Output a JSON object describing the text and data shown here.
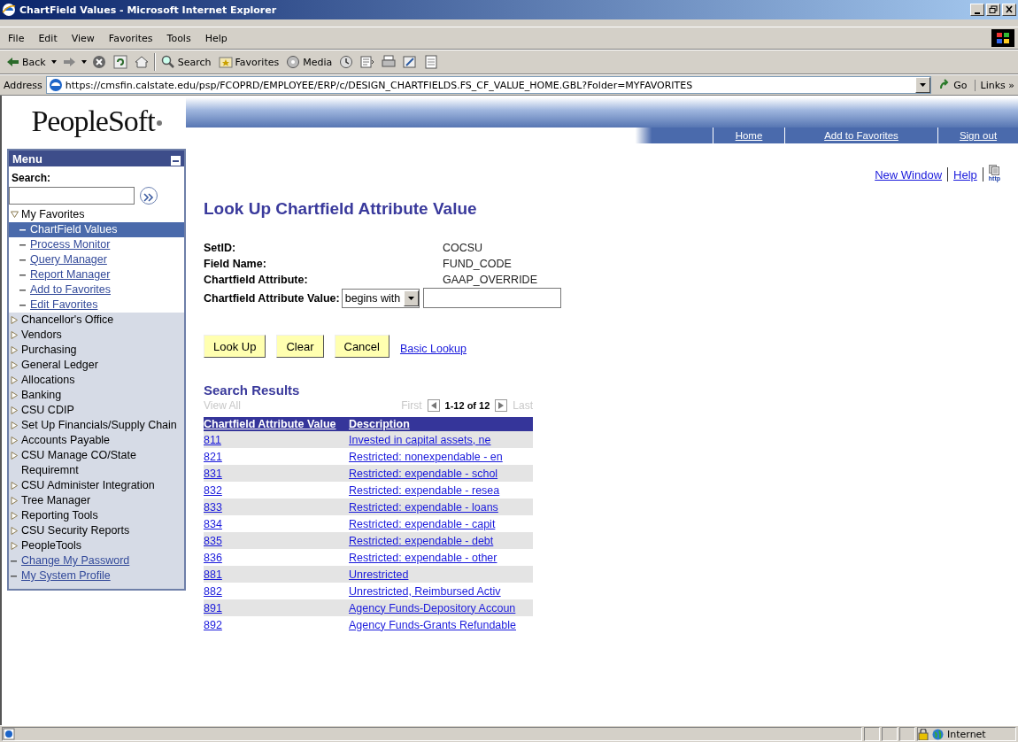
{
  "window": {
    "title": "ChartField Values - Microsoft Internet Explorer"
  },
  "menu_bar": [
    "File",
    "Edit",
    "View",
    "Favorites",
    "Tools",
    "Help"
  ],
  "toolbar": [
    {
      "kind": "back",
      "label": "Back"
    },
    {
      "kind": "forward"
    },
    {
      "kind": "stop"
    },
    {
      "kind": "refresh"
    },
    {
      "kind": "home"
    },
    {
      "kind": "search",
      "label": "Search"
    },
    {
      "kind": "favorites",
      "label": "Favorites"
    },
    {
      "kind": "media",
      "label": "Media"
    },
    {
      "kind": "history"
    },
    {
      "kind": "mail"
    },
    {
      "kind": "print"
    },
    {
      "kind": "edit"
    },
    {
      "kind": "discuss"
    }
  ],
  "address_bar": {
    "label": "Address",
    "url": "https://cmsfin.calstate.edu/psp/FCOPRD/EMPLOYEE/ERP/c/DESIGN_CHARTFIELDS.FS_CF_VALUE_HOME.GBL?Folder=MYFAVORITES",
    "go": "Go",
    "links": "Links »"
  },
  "logo": "PeopleSoft",
  "header_links": [
    "Home",
    "Add to Favorites",
    "Sign out"
  ],
  "menu": {
    "title": "Menu",
    "search_label": "Search:",
    "items": [
      {
        "kind": "folder",
        "label": "My Favorites",
        "expanded": true,
        "children": [
          {
            "kind": "link",
            "label": "ChartField Values",
            "selected": true
          },
          {
            "kind": "link",
            "label": "Process Monitor",
            "selected": false
          },
          {
            "kind": "link",
            "label": "Query Manager",
            "selected": false
          },
          {
            "kind": "link",
            "label": "Report Manager",
            "selected": false
          },
          {
            "kind": "link",
            "label": "Add to Favorites",
            "selected": false
          },
          {
            "kind": "link",
            "label": "Edit Favorites",
            "selected": false
          }
        ]
      },
      {
        "kind": "folder",
        "label": "Chancellor's Office",
        "expanded": false
      },
      {
        "kind": "folder",
        "label": "Vendors",
        "expanded": false
      },
      {
        "kind": "folder",
        "label": "Purchasing",
        "expanded": false
      },
      {
        "kind": "folder",
        "label": "General Ledger",
        "expanded": false
      },
      {
        "kind": "folder",
        "label": "Allocations",
        "expanded": false
      },
      {
        "kind": "folder",
        "label": "Banking",
        "expanded": false
      },
      {
        "kind": "folder",
        "label": "CSU CDIP",
        "expanded": false
      },
      {
        "kind": "folder",
        "label": "Set Up Financials/Supply Chain",
        "expanded": false
      },
      {
        "kind": "folder",
        "label": "Accounts Payable",
        "expanded": false
      },
      {
        "kind": "folder",
        "label": "CSU Manage CO/State Requiremnt",
        "expanded": false
      },
      {
        "kind": "folder",
        "label": "CSU Administer Integration",
        "expanded": false
      },
      {
        "kind": "folder",
        "label": "Tree Manager",
        "expanded": false
      },
      {
        "kind": "folder",
        "label": "Reporting Tools",
        "expanded": false
      },
      {
        "kind": "folder",
        "label": "CSU Security Reports",
        "expanded": false
      },
      {
        "kind": "folder",
        "label": "PeopleTools",
        "expanded": false
      },
      {
        "kind": "link",
        "label": "Change My Password",
        "selected": false
      },
      {
        "kind": "link",
        "label": "My System Profile",
        "selected": false
      }
    ]
  },
  "page_links": [
    "New Window",
    "Help"
  ],
  "http_icon_label": "http",
  "heading": "Look Up Chartfield Attribute Value",
  "fields": [
    {
      "label": "SetID:",
      "value": "COCSU"
    },
    {
      "label": "Field Name:",
      "value": "FUND_CODE"
    },
    {
      "label": "Chartfield Attribute:",
      "value": "GAAP_OVERRIDE"
    }
  ],
  "criteria": {
    "label": "Chartfield Attribute Value:",
    "operator": "begins with"
  },
  "buttons": [
    "Look Up",
    "Clear",
    "Cancel"
  ],
  "basic_lookup": "Basic Lookup",
  "results": {
    "title": "Search Results",
    "view_all": {
      "label": "View All",
      "disabled": true
    },
    "first": {
      "label": "First",
      "disabled": true
    },
    "range": "1-12 of 12",
    "last": {
      "label": "Last",
      "disabled": true
    },
    "columns": [
      "Chartfield Attribute Value",
      "Description"
    ],
    "rows": [
      {
        "value": "811",
        "description": "Invested in capital assets, ne"
      },
      {
        "value": "821",
        "description": "Restricted: nonexpendable - en"
      },
      {
        "value": "831",
        "description": "Restricted: expendable - schol"
      },
      {
        "value": "832",
        "description": "Restricted: expendable - resea"
      },
      {
        "value": "833",
        "description": "Restricted: expendable - loans"
      },
      {
        "value": "834",
        "description": "Restricted: expendable - capit"
      },
      {
        "value": "835",
        "description": "Restricted: expendable - debt"
      },
      {
        "value": "836",
        "description": "Restricted: expendable - other"
      },
      {
        "value": "881",
        "description": "Unrestricted"
      },
      {
        "value": "882",
        "description": "Unrestricted, Reimbursed Activ"
      },
      {
        "value": "891",
        "description": "Agency Funds-Depository Accoun"
      },
      {
        "value": "892",
        "description": "Agency Funds-Grants Refundable"
      }
    ]
  },
  "status_bar": {
    "zone": "Internet"
  }
}
